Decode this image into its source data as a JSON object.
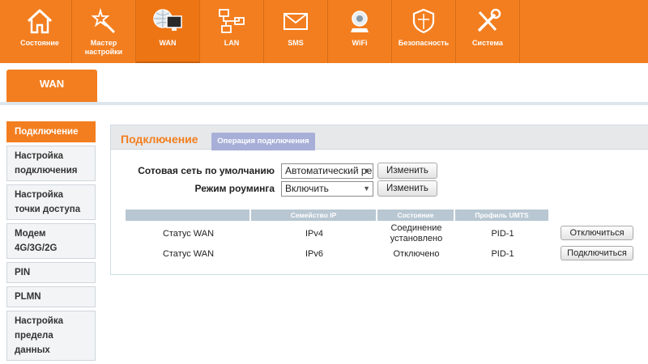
{
  "nav": {
    "items": [
      {
        "label": "Состояние",
        "icon": "home-icon"
      },
      {
        "label": "Мастер настройки",
        "icon": "wand-icon"
      },
      {
        "label": "WAN",
        "icon": "globe-monitor-icon"
      },
      {
        "label": "LAN",
        "icon": "network-icon"
      },
      {
        "label": "SMS",
        "icon": "envelope-icon"
      },
      {
        "label": "WiFi",
        "icon": "wifi-router-icon"
      },
      {
        "label": "Безопасность",
        "icon": "shield-icon"
      },
      {
        "label": "Система",
        "icon": "tools-icon"
      }
    ],
    "active_index": 2
  },
  "section_tab": "WAN",
  "sidebar": {
    "items": [
      {
        "label": "Подключение",
        "active": true
      },
      {
        "label": "Настройка подключения"
      },
      {
        "label": "Настройка точки доступа"
      },
      {
        "label": "Модем 4G/3G/2G"
      },
      {
        "label": "PIN"
      },
      {
        "label": "PLMN"
      },
      {
        "label": "Настройка предела данных"
      }
    ]
  },
  "panel": {
    "title": "Подключение",
    "tab": "Операция подключения"
  },
  "form": {
    "default_network_label": "Сотовая сеть по умолчанию",
    "default_network_value": "Автоматический ре",
    "roaming_label": "Режим роуминга",
    "roaming_value": "Включить",
    "change_label": "Изменить"
  },
  "table": {
    "headers": [
      "",
      "Семейство IP",
      "Состояние",
      "Профиль UMTS"
    ],
    "rows": [
      {
        "name": "Статус WAN",
        "family": "IPv4",
        "state": "Соединение установлено",
        "profile": "PID-1",
        "action": "Отключиться"
      },
      {
        "name": "Статус WAN",
        "family": "IPv6",
        "state": "Отключено",
        "profile": "PID-1",
        "action": "Подключиться"
      }
    ]
  },
  "colors": {
    "brand_orange": "#f37e1f",
    "tab_lilac": "#a7afd8",
    "table_header": "#b8c7d2"
  }
}
